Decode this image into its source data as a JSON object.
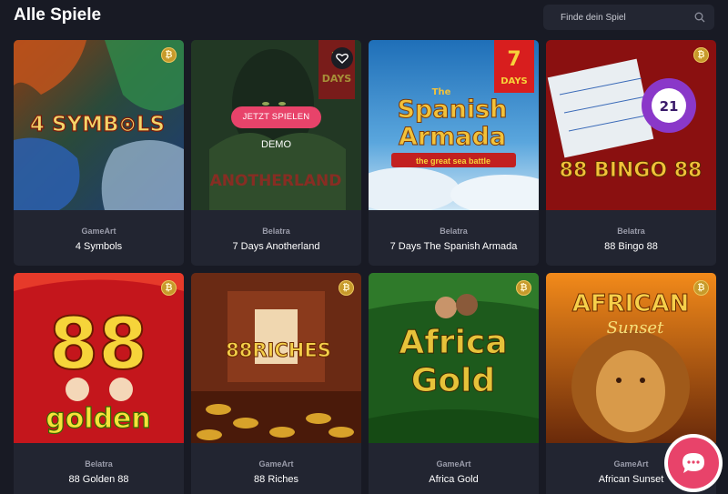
{
  "header": {
    "title": "Alle Spiele"
  },
  "search": {
    "placeholder": "Finde dein Spiel"
  },
  "hover": {
    "play_label": "JETZT SPIELEN",
    "demo_label": "DEMO"
  },
  "badges": {
    "coin_symbol": "₿"
  },
  "games": [
    {
      "provider": "GameArt",
      "name": "4 Symbols",
      "art_text": "4 SYMB⊙LS"
    },
    {
      "provider": "Belatra",
      "name": "7 Days Anotherland",
      "art_text": "ANOTHERLAND",
      "ribbon": [
        "7",
        "DAYS"
      ]
    },
    {
      "provider": "Belatra",
      "name": "7 Days The Spanish Armada",
      "art_text": [
        "The",
        "Spanish",
        "Armada",
        "the great sea battle"
      ],
      "ribbon": [
        "7",
        "DAYS"
      ]
    },
    {
      "provider": "Belatra",
      "name": "88 Bingo 88",
      "art_text": "88 BINGO 88",
      "ball": "21"
    },
    {
      "provider": "Belatra",
      "name": "88 Golden 88",
      "art_text": [
        "88",
        "golden"
      ]
    },
    {
      "provider": "GameArt",
      "name": "88 Riches",
      "art_text": "88RICHES"
    },
    {
      "provider": "GameArt",
      "name": "Africa Gold",
      "art_text": [
        "Africa",
        "Gold"
      ]
    },
    {
      "provider": "GameArt",
      "name": "African Sunset",
      "art_text": [
        "AFRICAN",
        "Sunset"
      ]
    }
  ],
  "colors": {
    "accent": "#e8436a",
    "background": "#181a24",
    "card": "#222531"
  }
}
